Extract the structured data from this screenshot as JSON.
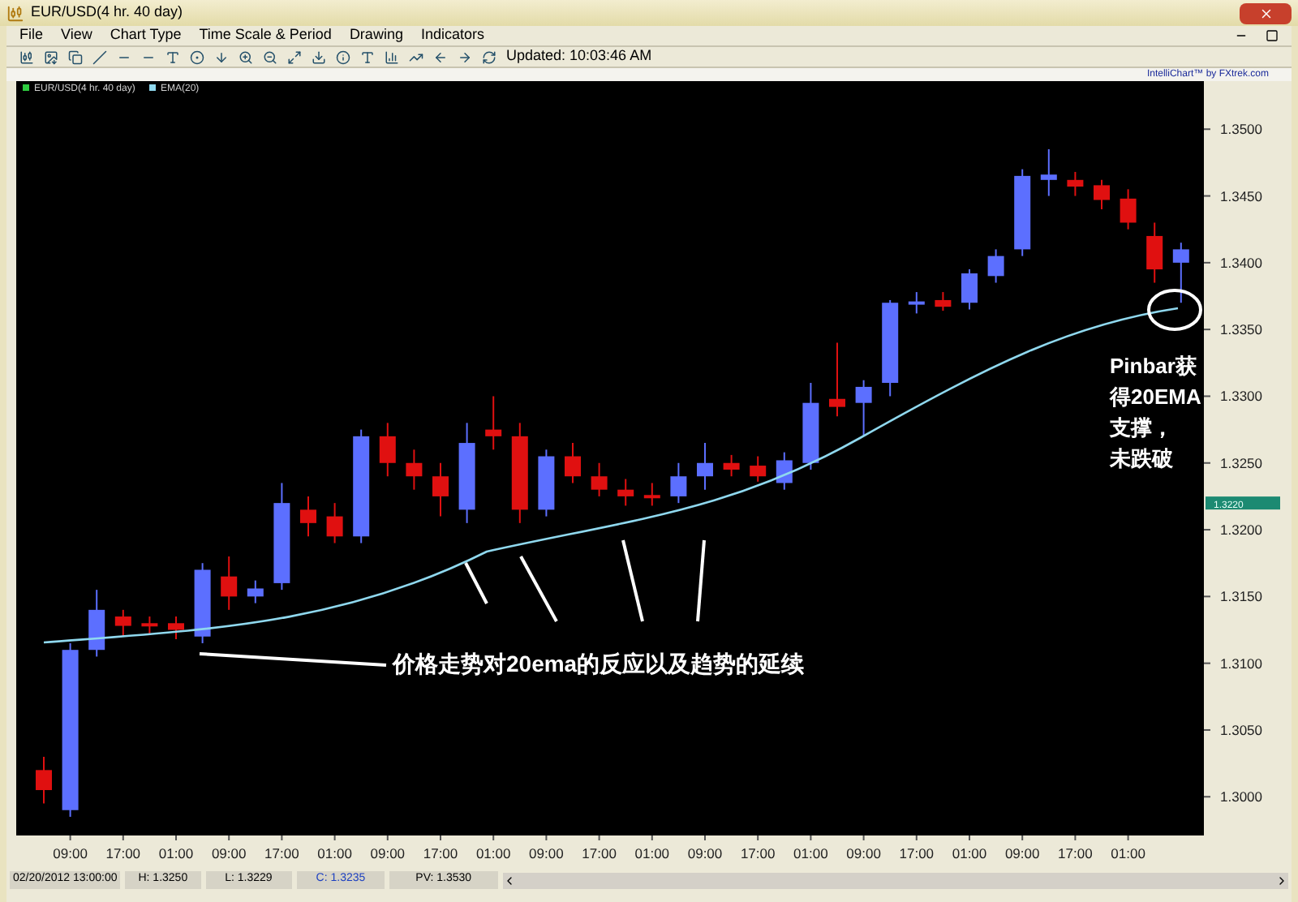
{
  "window": {
    "title": "EUR/USD(4 hr.  40 day)"
  },
  "menu": [
    "File",
    "View",
    "Chart Type",
    "Time Scale & Period",
    "Drawing",
    "Indicators"
  ],
  "toolbar": {
    "updated": "Updated: 10:03:46 AM"
  },
  "chart": {
    "legend": [
      {
        "label": "EUR/USD(4 hr.  40 day)",
        "color": "#2ecc40"
      },
      {
        "label": "EMA(20)",
        "color": "#8fd8ee"
      }
    ],
    "credit": "IntelliChart™ by FXtrek.com",
    "price_marker": "1.3220",
    "annotations": {
      "main": "价格走势对20ema的反应以及趋势的延续",
      "side": [
        "Pinbar获",
        "得20EMA",
        "支撑，",
        "未跌破"
      ]
    },
    "chart_data": {
      "type": "candlestick",
      "ylim": [
        1.2971,
        1.3536
      ],
      "categories": [
        null,
        "09:00",
        null,
        "17:00",
        null,
        "01:00",
        null,
        "09:00",
        null,
        "17:00",
        null,
        "01:00",
        null,
        "09:00",
        null,
        "17:00",
        null,
        "01:00",
        null,
        "09:00",
        null,
        "17:00",
        null,
        "01:00",
        null,
        "09:00",
        null,
        "17:00",
        null,
        "01:00",
        null,
        "09:00",
        null,
        "17:00",
        null,
        "01:00",
        null,
        "09:00",
        null,
        "17:00",
        null,
        "01:00",
        null,
        null
      ],
      "ohlc": [
        [
          1.302,
          1.303,
          1.2995,
          1.3005
        ],
        [
          1.299,
          1.3115,
          1.2985,
          1.311
        ],
        [
          1.311,
          1.3155,
          1.3105,
          1.314
        ],
        [
          1.3135,
          1.314,
          1.312,
          1.3128
        ],
        [
          1.313,
          1.3135,
          1.3122,
          1.3128
        ],
        [
          1.313,
          1.3135,
          1.3118,
          1.3125
        ],
        [
          1.312,
          1.3175,
          1.3115,
          1.317
        ],
        [
          1.3165,
          1.318,
          1.314,
          1.315
        ],
        [
          1.315,
          1.3162,
          1.3145,
          1.3156
        ],
        [
          1.316,
          1.3235,
          1.3155,
          1.322
        ],
        [
          1.3215,
          1.3225,
          1.3195,
          1.3205
        ],
        [
          1.321,
          1.322,
          1.319,
          1.3195
        ],
        [
          1.3195,
          1.3275,
          1.319,
          1.327
        ],
        [
          1.327,
          1.328,
          1.324,
          1.325
        ],
        [
          1.325,
          1.326,
          1.323,
          1.324
        ],
        [
          1.324,
          1.325,
          1.321,
          1.3225
        ],
        [
          1.3215,
          1.328,
          1.3205,
          1.3265
        ],
        [
          1.3275,
          1.33,
          1.326,
          1.327
        ],
        [
          1.327,
          1.328,
          1.3205,
          1.3215
        ],
        [
          1.3215,
          1.326,
          1.321,
          1.3255
        ],
        [
          1.3255,
          1.3265,
          1.3235,
          1.324
        ],
        [
          1.324,
          1.325,
          1.3225,
          1.323
        ],
        [
          1.323,
          1.3238,
          1.3218,
          1.3225
        ],
        [
          1.3226,
          1.3235,
          1.3218,
          1.3225
        ],
        [
          1.3225,
          1.325,
          1.322,
          1.324
        ],
        [
          1.324,
          1.3265,
          1.323,
          1.325
        ],
        [
          1.325,
          1.3256,
          1.324,
          1.3245
        ],
        [
          1.3248,
          1.3255,
          1.3236,
          1.324
        ],
        [
          1.3235,
          1.3258,
          1.323,
          1.3252
        ],
        [
          1.325,
          1.331,
          1.3245,
          1.3295
        ],
        [
          1.3298,
          1.334,
          1.3285,
          1.3292
        ],
        [
          1.3295,
          1.3312,
          1.327,
          1.3307
        ],
        [
          1.331,
          1.3372,
          1.33,
          1.337
        ],
        [
          1.3369,
          1.3378,
          1.3362,
          1.3371
        ],
        [
          1.3372,
          1.3378,
          1.3364,
          1.3367
        ],
        [
          1.337,
          1.3395,
          1.3365,
          1.3392
        ],
        [
          1.339,
          1.341,
          1.3385,
          1.3405
        ],
        [
          1.341,
          1.347,
          1.3405,
          1.3465
        ],
        [
          1.3462,
          1.3485,
          1.345,
          1.3466
        ],
        [
          1.3462,
          1.3468,
          1.345,
          1.3457
        ],
        [
          1.3458,
          1.3462,
          1.344,
          1.3447
        ],
        [
          1.3448,
          1.3455,
          1.3425,
          1.343
        ],
        [
          1.342,
          1.343,
          1.3385,
          1.3395
        ],
        [
          1.34,
          1.3415,
          1.337,
          1.341
        ]
      ],
      "yticks": [
        {
          "value": 1.3,
          "label": "1.3000"
        },
        {
          "value": 1.305,
          "label": "1.3050"
        },
        {
          "value": 1.31,
          "label": "1.3100"
        },
        {
          "value": 1.315,
          "label": "1.3150"
        },
        {
          "value": 1.32,
          "label": "1.3200"
        },
        {
          "value": 1.325,
          "label": "1.3250"
        },
        {
          "value": 1.33,
          "label": "1.3300"
        },
        {
          "value": 1.335,
          "label": "1.3350"
        },
        {
          "value": 1.34,
          "label": "1.3400"
        },
        {
          "value": 1.345,
          "label": "1.3450"
        },
        {
          "value": 1.35,
          "label": "1.3500"
        }
      ]
    }
  },
  "status": {
    "date": "02/20/2012 13:00:00",
    "high": "H: 1.3250",
    "low": "L: 1.3229",
    "close": "C: 1.3235",
    "pv": "PV: 1.3530"
  }
}
